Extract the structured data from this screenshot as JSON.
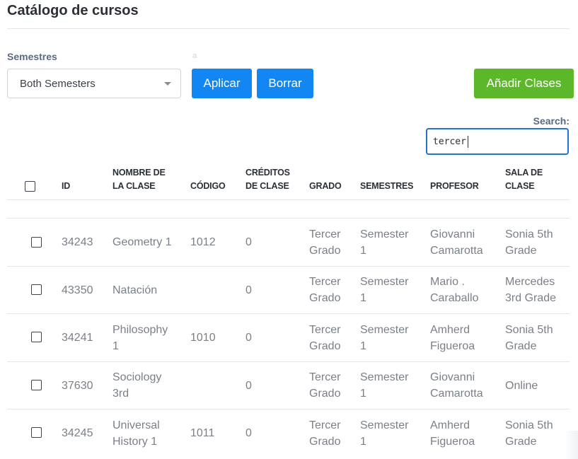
{
  "page": {
    "title": "Catálogo de cursos"
  },
  "filters": {
    "semester_label": "Semestres",
    "semester_selected": "Both Semesters",
    "faint_mark": "a",
    "apply_label": "Aplicar",
    "clear_label": "Borrar",
    "add_label": "Añadir Clases"
  },
  "search": {
    "label": "Search:",
    "value": "tercer"
  },
  "table": {
    "headers": {
      "id": "ID",
      "name_1": "NOMBRE DE",
      "name_2": "LA CLASE",
      "code": "CÓDIGO",
      "credits_1": "CRÉDITOS",
      "credits_2": "DE CLASE",
      "grade": "GRADO",
      "semester": "SEMESTRES",
      "teacher": "PROFESOR",
      "room_1": "SALA DE",
      "room_2": "CLASE"
    },
    "rows": [
      {
        "id": "34243",
        "name_1": "Geometry 1",
        "name_2": "",
        "code": "1012",
        "credits": "0",
        "grade_1": "Tercer",
        "grade_2": "Grado",
        "sem_1": "Semester",
        "sem_2": "1",
        "teacher_1": "Giovanni",
        "teacher_2": "Camarotta",
        "room_1": "Sonia 5th",
        "room_2": "Grade"
      },
      {
        "id": "43350",
        "name_1": "Natación",
        "name_2": "",
        "code": "",
        "credits": "0",
        "grade_1": "Tercer",
        "grade_2": "Grado",
        "sem_1": "Semester",
        "sem_2": "1",
        "teacher_1": "Mario .",
        "teacher_2": "Caraballo",
        "room_1": "Mercedes",
        "room_2": "3rd Grade"
      },
      {
        "id": "34241",
        "name_1": "Philosophy",
        "name_2": "1",
        "code": "1010",
        "credits": "0",
        "grade_1": "Tercer",
        "grade_2": "Grado",
        "sem_1": "Semester",
        "sem_2": "1",
        "teacher_1": "Amherd",
        "teacher_2": "Figueroa",
        "room_1": "Sonia 5th",
        "room_2": "Grade"
      },
      {
        "id": "37630",
        "name_1": "Sociology",
        "name_2": "3rd",
        "code": "",
        "credits": "0",
        "grade_1": "Tercer",
        "grade_2": "Grado",
        "sem_1": "Semester",
        "sem_2": "1",
        "teacher_1": "Giovanni",
        "teacher_2": "Camarotta",
        "room_1": "Online",
        "room_2": ""
      },
      {
        "id": "34245",
        "name_1": "Universal",
        "name_2": "History 1",
        "code": "1011",
        "credits": "0",
        "grade_1": "Tercer",
        "grade_2": "Grado",
        "sem_1": "Semester",
        "sem_2": "1",
        "teacher_1": "Amherd",
        "teacher_2": "Figueroa",
        "room_1": "Sonia 5th",
        "room_2": "Grade"
      }
    ]
  }
}
